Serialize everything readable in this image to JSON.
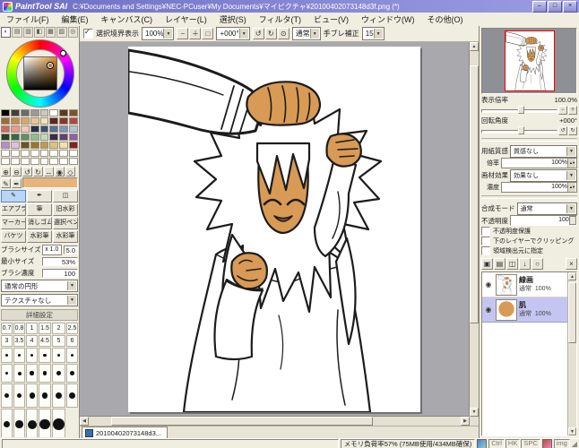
{
  "titlebar": {
    "app_name": "PaintTool SAI",
    "document_path": "C:¥Documents and Settings¥NEC-PCuser¥My Documents¥マイピクチャ¥20100402073148d3f.png (*)",
    "minimize_label": "–",
    "maximize_label": "□",
    "close_label": "×"
  },
  "menu": {
    "items": [
      "ファイル(F)",
      "編集(E)",
      "キャンバス(C)",
      "レイヤー(L)",
      "選択(S)",
      "フィルタ(T)",
      "ビュー(V)",
      "ウィンドウ(W)",
      "その他(O)"
    ]
  },
  "toolbar": {
    "selection_border_label": "選択境界表示",
    "zoom_value": "100%",
    "zoom_buttons": [
      {
        "name": "zoom-out-button",
        "glyph": "−"
      },
      {
        "name": "zoom-in-button",
        "glyph": "＋"
      },
      {
        "name": "zoom-reset-button",
        "glyph": "□"
      }
    ],
    "angle_value": "+000°",
    "angle_buttons": [
      {
        "name": "rotate-ccw-button",
        "glyph": "↺"
      },
      {
        "name": "rotate-cw-button",
        "glyph": "↻"
      },
      {
        "name": "rotate-reset-button",
        "glyph": "⊙"
      }
    ],
    "mode_value": "通常",
    "stabilizer_label": "手ブレ補正",
    "stabilizer_value": "15"
  },
  "color_panel": {
    "tabs": [
      {
        "name": "color-wheel-icon",
        "glyph": "◐"
      },
      {
        "name": "rgb-sliders-icon",
        "glyph": "▤"
      },
      {
        "name": "hsv-sliders-icon",
        "glyph": "▥"
      },
      {
        "name": "color-mixer-icon",
        "glyph": "◧"
      },
      {
        "name": "swatches-icon",
        "glyph": "▦"
      },
      {
        "name": "scratchpad-icon",
        "glyph": "▨"
      },
      {
        "name": "picker-icon",
        "glyph": "◎"
      }
    ],
    "selected_color": "#e9b47c",
    "swatches": [
      "#000000",
      "#404040",
      "#6b6b6b",
      "#9a9a9a",
      "#c8c8c8",
      "#ffffff",
      "#5a3a22",
      "#7d5231",
      "#a06a3c",
      "#c08a52",
      "#d9a868",
      "#eac493",
      "#f5e0c2",
      "#612424",
      "#8a3434",
      "#b04848",
      "#d06868",
      "#e89a92",
      "#f2c4bc",
      "#24324e",
      "#3a5070",
      "#557098",
      "#7e96bc",
      "#aec2da",
      "#24422c",
      "#3c6848",
      "#5f9068",
      "#8cbc92",
      "#bcdcc0",
      "#3c2852",
      "#604078",
      "#8a62a8",
      "#b68cd0",
      "#dcc0ea",
      "#6e5420",
      "#947830",
      "#bc9c50",
      "#dcc47c",
      "#f0e2aa",
      "#822222",
      "#ffffff",
      "#ffffff",
      "#ffffff",
      "#ffffff",
      "#ffffff",
      "#ffffff",
      "#ffffff",
      "#ffffff",
      "#ffffff",
      "#ffffff",
      "#ffffff",
      "#ffffff",
      "#ffffff",
      "#ffffff",
      "#ffffff",
      "#ffffff"
    ]
  },
  "tool_panel": {
    "view_tools": [
      {
        "name": "zoom-in-icon",
        "glyph": "⊕"
      },
      {
        "name": "zoom-out-icon",
        "glyph": "⊖"
      },
      {
        "name": "rotate-ccw-icon",
        "glyph": "↺"
      },
      {
        "name": "rotate-cw-icon",
        "glyph": "↻"
      },
      {
        "name": "move-icon",
        "glyph": "↔"
      },
      {
        "name": "eyedropper-icon",
        "glyph": "◉"
      },
      {
        "name": "hand-icon",
        "glyph": "◇"
      }
    ],
    "pen_tools": [
      {
        "name": "pencil-icon",
        "glyph": "✎"
      },
      {
        "name": "pen-icon",
        "glyph": "✒"
      }
    ],
    "tools": [
      {
        "name": "pencil-tool",
        "glyph": "✎",
        "label": "",
        "selected": true
      },
      {
        "name": "pen-tool",
        "glyph": "✒",
        "label": "",
        "selected": false
      },
      {
        "name": "binder-tool",
        "glyph": "◫",
        "label": "",
        "selected": false
      },
      {
        "name": "airbrush-tool",
        "label": "エアブラシ",
        "selected": false
      },
      {
        "name": "brush-tool",
        "label": "筆",
        "selected": false
      },
      {
        "name": "legacy-watercolor-tool",
        "label": "旧水彩",
        "selected": false
      },
      {
        "name": "marker-tool",
        "label": "マーカー",
        "selected": false
      },
      {
        "name": "eraser-tool",
        "label": "消しゴム",
        "selected": false
      },
      {
        "name": "select-pen-tool",
        "label": "選択ペン",
        "selected": false
      },
      {
        "name": "bucket-tool",
        "label": "バケツ",
        "selected": false
      },
      {
        "name": "watercolor-tool",
        "label": "水彩筆",
        "selected": false
      },
      {
        "name": "watercolor2-tool",
        "label": "水彩筆",
        "selected": false
      }
    ]
  },
  "brush": {
    "size_label": "ブラシサイズ",
    "size_unit": "x 1.0",
    "size_value": "5.0",
    "min_label": "最小サイズ",
    "min_value": "53%",
    "density_label": "ブラシ濃度",
    "density_value": "100",
    "shape_value": "通常の円形",
    "texture_value": "テクスチャなし",
    "advanced_label": "詳細設定"
  },
  "size_presets": {
    "text_rows": [
      [
        "0.7",
        "0.8",
        "1",
        "1.5",
        "2",
        "2.5"
      ],
      [
        "3",
        "3.5",
        "4",
        "4.5",
        "5",
        "6"
      ]
    ],
    "dot_rows": [
      [
        7,
        8,
        9,
        10,
        12,
        14
      ],
      [
        16,
        18,
        20,
        25,
        30,
        35
      ],
      [
        40,
        50,
        60,
        70,
        80,
        90
      ],
      [
        100,
        150,
        200,
        300,
        500
      ]
    ]
  },
  "canvas": {
    "tab_label": "20100402073148d3..."
  },
  "navigator": {
    "zoom_label": "表示倍率",
    "zoom_value": "100.0%",
    "angle_label": "回転角度",
    "angle_value": "+000°"
  },
  "paper": {
    "texture_label": "用紙質感",
    "texture_value": "質感なし",
    "texture_scale_label": "倍率",
    "texture_scale_value": "100%",
    "effect_label": "画材効果",
    "effect_value": "効果なし",
    "effect_scale_label": "濃度",
    "effect_scale_value": "100%"
  },
  "layer_panel": {
    "mode_label": "合成モード",
    "mode_value": "通常",
    "opacity_label": "不透明度",
    "opacity_value": "100%",
    "options": [
      "不透明度保護",
      "下のレイヤーでクリッピング",
      "領域検出元に指定"
    ],
    "toolbar_icons": [
      {
        "name": "new-layer-icon",
        "glyph": "▣"
      },
      {
        "name": "new-layer-set-icon",
        "glyph": "▤"
      },
      {
        "name": "duplicate-layer-icon",
        "glyph": "◫"
      },
      {
        "name": "merge-down-icon",
        "glyph": "↓"
      },
      {
        "name": "clear-layer-icon",
        "glyph": "○"
      },
      {
        "name": "delete-layer-icon",
        "glyph": "×"
      }
    ],
    "layers": [
      {
        "name": "線画",
        "mode": "通常",
        "opacity": "100%",
        "selected": false,
        "thumb": "lineart"
      },
      {
        "name": "肌",
        "mode": "通常",
        "opacity": "100%",
        "selected": true,
        "thumb": "skin"
      }
    ]
  },
  "statusbar": {
    "memory_text": "メモリ負荷率57% (75MB使用/434MB確保)",
    "indicators": [
      "Ctrl",
      "HK",
      "SPC"
    ],
    "img_label": "img"
  }
}
